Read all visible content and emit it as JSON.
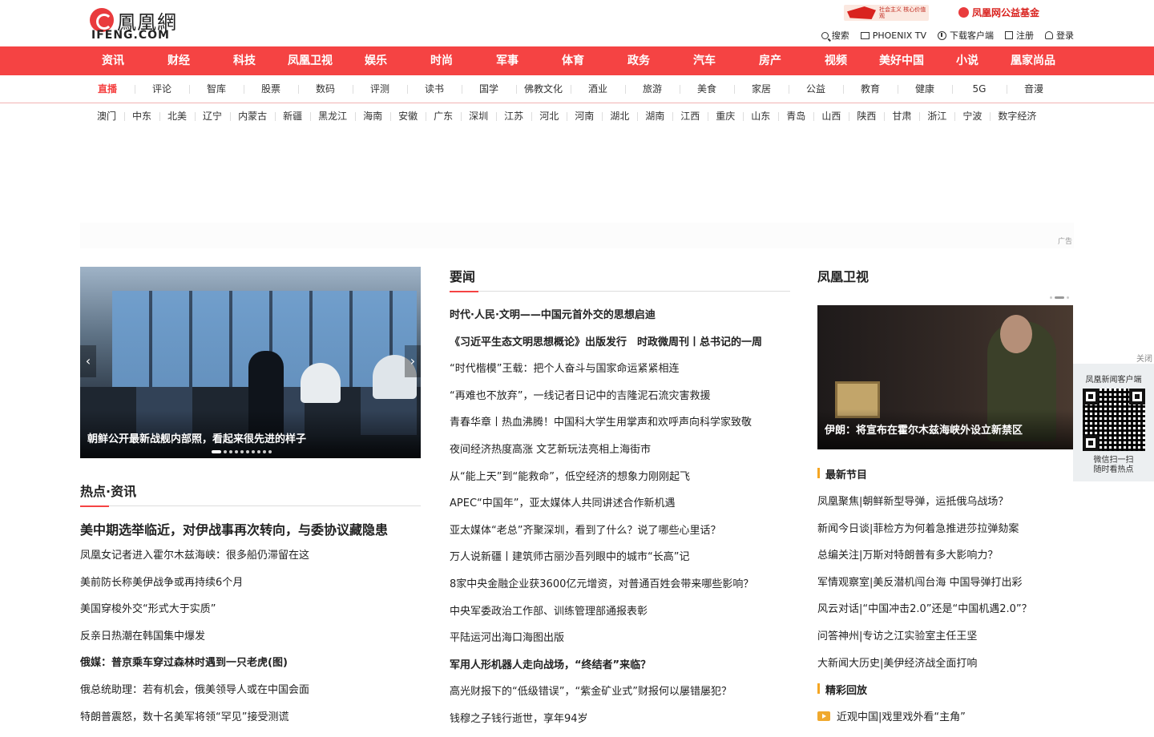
{
  "header": {
    "logo_cn": "鳳凰網",
    "logo_en": "IFENG.COM",
    "promo1_text": "社会主义 核心价值观",
    "promo2_text": "凤凰网公益基金",
    "toolbar": [
      {
        "label": "搜索",
        "icon": "search-icon"
      },
      {
        "label": "PHOENIX TV",
        "icon": "tv-icon"
      },
      {
        "label": "下载客户端",
        "icon": "download-icon"
      },
      {
        "label": "注册",
        "icon": "register-icon"
      },
      {
        "label": "登录",
        "icon": "user-icon"
      }
    ]
  },
  "nav_main": [
    "资讯",
    "财经",
    "科技",
    "凤凰卫视",
    "娱乐",
    "时尚",
    "军事",
    "体育",
    "政务",
    "汽车",
    "房产",
    "视频",
    "美好中国",
    "小说",
    "凰家尚品"
  ],
  "nav_sub": [
    "直播",
    "评论",
    "智库",
    "股票",
    "数码",
    "评测",
    "读书",
    "国学",
    "佛教文化",
    "酒业",
    "旅游",
    "美食",
    "家居",
    "公益",
    "教育",
    "健康",
    "5G",
    "音漫"
  ],
  "nav_region": [
    "澳门",
    "中东",
    "北美",
    "辽宁",
    "内蒙古",
    "新疆",
    "黑龙江",
    "海南",
    "安徽",
    "广东",
    "深圳",
    "江苏",
    "河北",
    "河南",
    "湖北",
    "湖南",
    "江西",
    "重庆",
    "山东",
    "青岛",
    "山西",
    "陕西",
    "甘肃",
    "浙江",
    "宁波",
    "数字经济"
  ],
  "ad_label": "广告",
  "slider": {
    "caption": "朝鲜公开最新战舰内部照，看起来很先进的样子",
    "prev": "‹",
    "next": "›",
    "dot_count": 10,
    "active_dot": 1
  },
  "hot": {
    "title": "热点·资讯",
    "lead": "美中期选举临近，对伊战事再次转向，与委协议藏隐患",
    "items": [
      {
        "text": "凤凰女记者进入霍尔木兹海峡：很多船仍滞留在这",
        "bold": false
      },
      {
        "text": "美前防长称美伊战争或再持续6个月",
        "bold": false
      },
      {
        "text": "美国穿梭外交“形式大于实质”",
        "bold": false
      },
      {
        "text": "反亲日热潮在韩国集中爆发",
        "bold": false
      },
      {
        "text": "俄媒：普京乘车穿过森林时遇到一只老虎(图)",
        "bold": true
      },
      {
        "text": "俄总统助理：若有机会，俄美领导人或在中国会面",
        "bold": false
      },
      {
        "text": "特朗普震怒，数十名美军将领“罕见”接受测谎",
        "bold": false
      }
    ]
  },
  "news": {
    "title": "要闻",
    "items": [
      {
        "text": "时代·人民·文明——中国元首外交的思想启迪",
        "bold": true
      },
      {
        "text": "《习近平生态文明思想概论》出版发行　时政微周刊丨总书记的一周",
        "bold": true
      },
      {
        "text": "“时代楷模”王载：把个人奋斗与国家命运紧紧相连",
        "bold": false
      },
      {
        "text": "“再难也不放弃”，一线记者日记中的吉隆泥石流灾害救援",
        "bold": false
      },
      {
        "text": "青春华章丨热血沸腾！中国科大学生用掌声和欢呼声向科学家致敬",
        "bold": false
      },
      {
        "text": "夜间经济热度高涨 文艺新玩法亮相上海街市",
        "bold": false
      },
      {
        "text": "从“能上天”到“能救命”，低空经济的想象力刚刚起飞",
        "bold": false
      },
      {
        "text": "APEC“中国年”，亚太媒体人共同讲述合作新机遇",
        "bold": false
      },
      {
        "text": "亚太媒体“老总”齐聚深圳，看到了什么？说了哪些心里话？",
        "bold": false
      },
      {
        "text": "万人说新疆丨建筑师古丽沙吾列眼中的城市“长高”记",
        "bold": false
      },
      {
        "text": "8家中央金融企业获3600亿元增资，对普通百姓会带来哪些影响？",
        "bold": false
      },
      {
        "text": "中央军委政治工作部、训练管理部通报表彰",
        "bold": false
      },
      {
        "text": "平陆运河出海口海图出版",
        "bold": false
      },
      {
        "text": "军用人形机器人走向战场，“终结者”来临？",
        "bold": true
      },
      {
        "text": "高光财报下的“低级错误”，“紫金矿业式”财报何以屡错屡犯？",
        "bold": false
      },
      {
        "text": "钱穆之子钱行逝世，享年94岁",
        "bold": false
      }
    ]
  },
  "phoenix_tv": {
    "title": "凤凰卫视",
    "video_caption": "伊朗：将宣布在霍尔木兹海峡外设立新禁区",
    "latest_title": "最新节目",
    "latest": [
      "凤凰聚焦|朝鲜新型导弹，运抵俄乌战场？",
      "新闻今日谈|菲检方为何着急推进莎拉弹劾案",
      "总编关注|万斯对特朗普有多大影响力？",
      "军情观察室|美反潜机闯台海 中国导弹打出彩",
      "风云对话|“中国冲击2.0”还是“中国机遇2.0”？",
      "问答神州|专访之江实验室主任王坚",
      "大新闻大历史|美伊经济战全面打响"
    ],
    "replay_title": "精彩回放",
    "replay": [
      "近观中国|戏里戏外看“主角”"
    ]
  },
  "qr_widget": {
    "close": "关闭",
    "title": "凤凰新闻客户端",
    "line1": "微信扫一扫",
    "line2": "随时看热点"
  },
  "colors": {
    "brand_red": "#f54343",
    "accent_orange": "#f5a623"
  }
}
